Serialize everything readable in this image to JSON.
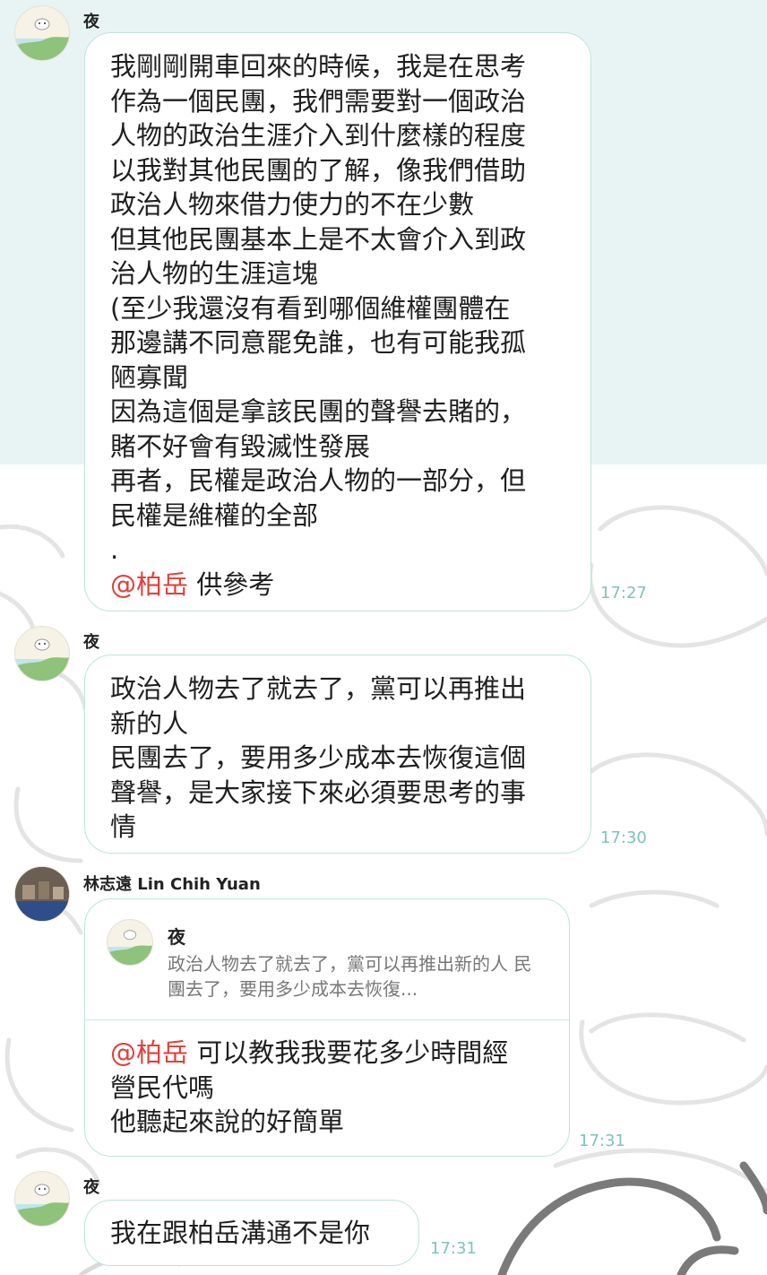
{
  "messages": [
    {
      "sender": "夜",
      "avatar": "user-avatar-ye",
      "lines": [
        "我剛剛開車回來的時候，我是在思考",
        "作為一個民團，我們需要對一個政治",
        "人物的政治生涯介入到什麼樣的程度",
        "以我對其他民團的了解，像我們借助",
        "政治人物來借力使力的不在少數",
        "但其他民團基本上是不太會介入到政",
        "治人物的生涯這塊",
        "(至少我還沒有看到哪個維權團體在",
        "那邊講不同意罷免誰，也有可能我孤",
        "陋寡聞",
        "因為這個是拿該民團的聲譽去賭的，",
        "賭不好會有毀滅性發展",
        "再者，民權是政治人物的一部分，但",
        "民權是維權的全部",
        "."
      ],
      "mention": "@柏岳",
      "mention_rest": " 供參考",
      "time": "17:27"
    },
    {
      "sender": "夜",
      "lines": [
        "政治人物去了就去了，黨可以再推出",
        "新的人",
        "民團去了，要用多少成本去恢復這個",
        "聲譽，是大家接下來必須要思考的事",
        "情"
      ],
      "time": "17:30"
    },
    {
      "sender": "林志遠 Lin Chih Yuan",
      "quote_sender": "夜",
      "quote_text": "政治人物去了就去了，黨可以再推出新的人 民團去了，要用多少成本去恢復...",
      "mention": "@柏岳",
      "mention_rest": " 可以教我我要花多少時間經",
      "lines": [
        "營民代嗎",
        "他聽起來說的好簡單"
      ],
      "time": "17:31"
    },
    {
      "sender": "夜",
      "lines": [
        "我在跟柏岳溝通不是你"
      ],
      "time": "17:31"
    }
  ],
  "colors": {
    "bubble_border": "#bfe3de",
    "time": "#7cc4bb",
    "mention": "#e0403a",
    "top_background": "#e8f4f3"
  }
}
